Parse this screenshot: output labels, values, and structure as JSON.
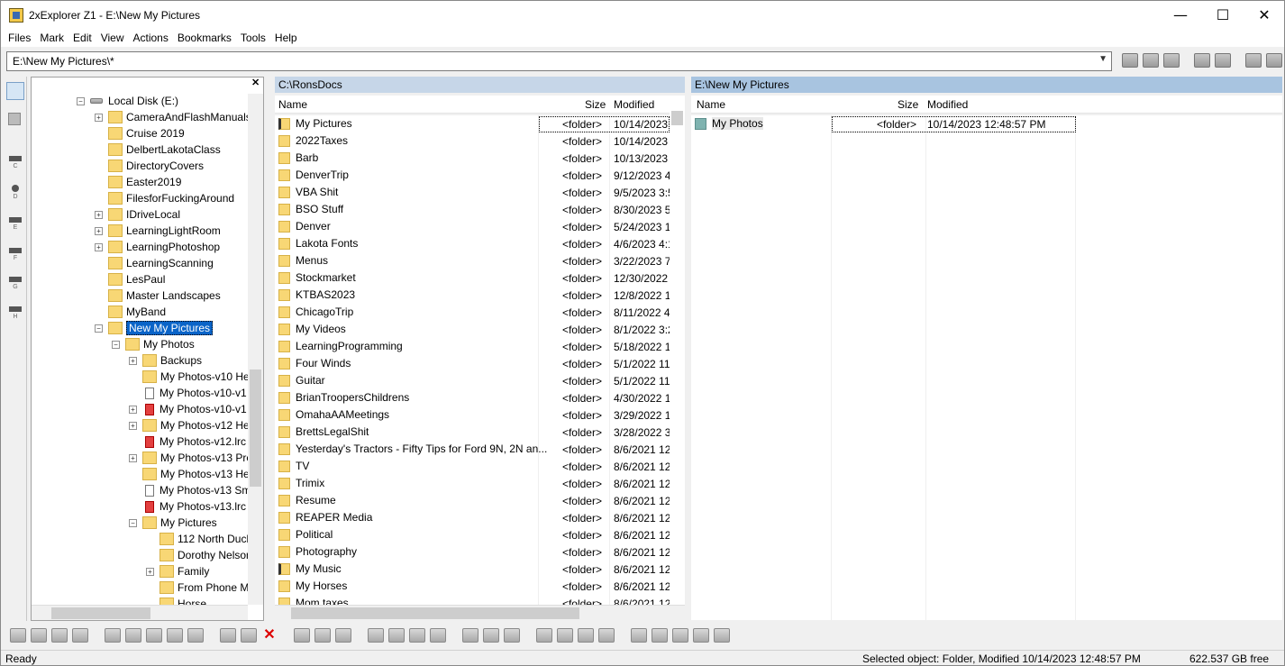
{
  "window": {
    "title": "2xExplorer Z1 - E:\\New My Pictures",
    "minimize": "—",
    "maximize": "☐",
    "close": "✕"
  },
  "menu": [
    "Files",
    "Mark",
    "Edit",
    "View",
    "Actions",
    "Bookmarks",
    "Tools",
    "Help"
  ],
  "path_input": {
    "value": "E:\\New My Pictures\\*"
  },
  "drives": [
    "C",
    "D",
    "E",
    "F",
    "G",
    "H"
  ],
  "tree": {
    "close_label": "✕",
    "nodes": [
      {
        "label": "Local Disk (E:)",
        "level": 0,
        "type": "drive",
        "expand": "-"
      },
      {
        "label": "CameraAndFlashManuals",
        "level": 1,
        "type": "folder",
        "expand": "+"
      },
      {
        "label": "Cruise 2019",
        "level": 1,
        "type": "folder",
        "expand": ""
      },
      {
        "label": "DelbertLakotaClass",
        "level": 1,
        "type": "folder",
        "expand": ""
      },
      {
        "label": "DirectoryCovers",
        "level": 1,
        "type": "folder",
        "expand": ""
      },
      {
        "label": "Easter2019",
        "level": 1,
        "type": "folder",
        "expand": ""
      },
      {
        "label": "FilesforFuckingAround",
        "level": 1,
        "type": "folder",
        "expand": ""
      },
      {
        "label": "IDriveLocal",
        "level": 1,
        "type": "folder",
        "expand": "+"
      },
      {
        "label": "LearningLightRoom",
        "level": 1,
        "type": "folder",
        "expand": "+"
      },
      {
        "label": "LearningPhotoshop",
        "level": 1,
        "type": "folder",
        "expand": "+"
      },
      {
        "label": "LearningScanning",
        "level": 1,
        "type": "folder",
        "expand": ""
      },
      {
        "label": "LesPaul",
        "level": 1,
        "type": "folder",
        "expand": ""
      },
      {
        "label": "Master Landscapes",
        "level": 1,
        "type": "folder",
        "expand": ""
      },
      {
        "label": "MyBand",
        "level": 1,
        "type": "folder",
        "expand": ""
      },
      {
        "label": "New My Pictures",
        "level": 1,
        "type": "folder",
        "expand": "-",
        "selected": true
      },
      {
        "label": "My Photos",
        "level": 2,
        "type": "folder",
        "expand": "-"
      },
      {
        "label": "Backups",
        "level": 3,
        "type": "folder",
        "expand": "+"
      },
      {
        "label": "My Photos-v10 He",
        "level": 3,
        "type": "folder",
        "expand": ""
      },
      {
        "label": "My Photos-v10-v1",
        "level": 3,
        "type": "doc",
        "expand": ""
      },
      {
        "label": "My Photos-v10-v1",
        "level": 3,
        "type": "docred",
        "expand": "+"
      },
      {
        "label": "My Photos-v12 He",
        "level": 3,
        "type": "folder",
        "expand": "+"
      },
      {
        "label": "My Photos-v12.lrc",
        "level": 3,
        "type": "docred",
        "expand": ""
      },
      {
        "label": "My Photos-v13 Pre",
        "level": 3,
        "type": "folder",
        "expand": "+"
      },
      {
        "label": "My Photos-v13 He",
        "level": 3,
        "type": "folder",
        "expand": ""
      },
      {
        "label": "My Photos-v13 Sm",
        "level": 3,
        "type": "doc",
        "expand": ""
      },
      {
        "label": "My Photos-v13.lrc",
        "level": 3,
        "type": "docred",
        "expand": ""
      },
      {
        "label": "My Pictures",
        "level": 3,
        "type": "folder",
        "expand": "-"
      },
      {
        "label": "112 North Duck",
        "level": 4,
        "type": "folder",
        "expand": ""
      },
      {
        "label": "Dorothy Nelson",
        "level": 4,
        "type": "folder",
        "expand": ""
      },
      {
        "label": "Family",
        "level": 4,
        "type": "folder",
        "expand": "+"
      },
      {
        "label": "From Phone M",
        "level": 4,
        "type": "folder",
        "expand": ""
      },
      {
        "label": "Horse",
        "level": 4,
        "type": "folder",
        "expand": ""
      }
    ]
  },
  "left_pane": {
    "path": "C:\\RonsDocs",
    "columns": {
      "name": "Name",
      "size": "Size",
      "modified": "Modified"
    },
    "rows": [
      {
        "name": "My Pictures",
        "size": "<folder>",
        "modified": "10/14/2023",
        "special": true
      },
      {
        "name": "2022Taxes",
        "size": "<folder>",
        "modified": "10/14/2023"
      },
      {
        "name": "Barb",
        "size": "<folder>",
        "modified": "10/13/2023"
      },
      {
        "name": "DenverTrip",
        "size": "<folder>",
        "modified": "9/12/2023 4"
      },
      {
        "name": "VBA Shit",
        "size": "<folder>",
        "modified": "9/5/2023 3:5"
      },
      {
        "name": "BSO Stuff",
        "size": "<folder>",
        "modified": "8/30/2023 5"
      },
      {
        "name": "Denver",
        "size": "<folder>",
        "modified": "5/24/2023 1"
      },
      {
        "name": "Lakota Fonts",
        "size": "<folder>",
        "modified": "4/6/2023 4:1"
      },
      {
        "name": "Menus",
        "size": "<folder>",
        "modified": "3/22/2023 7"
      },
      {
        "name": "Stockmarket",
        "size": "<folder>",
        "modified": "12/30/2022"
      },
      {
        "name": "KTBAS2023",
        "size": "<folder>",
        "modified": "12/8/2022 1"
      },
      {
        "name": "ChicagoTrip",
        "size": "<folder>",
        "modified": "8/11/2022 4"
      },
      {
        "name": "My Videos",
        "size": "<folder>",
        "modified": "8/1/2022 3:2"
      },
      {
        "name": "LearningProgramming",
        "size": "<folder>",
        "modified": "5/18/2022 1"
      },
      {
        "name": "Four Winds",
        "size": "<folder>",
        "modified": "5/1/2022 11"
      },
      {
        "name": "Guitar",
        "size": "<folder>",
        "modified": "5/1/2022 11"
      },
      {
        "name": "BrianTroopersChildrens",
        "size": "<folder>",
        "modified": "4/30/2022 1"
      },
      {
        "name": "OmahaAAMeetings",
        "size": "<folder>",
        "modified": "3/29/2022 1"
      },
      {
        "name": "BrettsLegalShit",
        "size": "<folder>",
        "modified": "3/28/2022 3"
      },
      {
        "name": "Yesterday's Tractors - Fifty Tips for Ford 9N, 2N an...",
        "size": "<folder>",
        "modified": "8/6/2021 12"
      },
      {
        "name": "TV",
        "size": "<folder>",
        "modified": "8/6/2021 12"
      },
      {
        "name": "Trimix",
        "size": "<folder>",
        "modified": "8/6/2021 12"
      },
      {
        "name": "Resume",
        "size": "<folder>",
        "modified": "8/6/2021 12"
      },
      {
        "name": "REAPER Media",
        "size": "<folder>",
        "modified": "8/6/2021 12"
      },
      {
        "name": "Political",
        "size": "<folder>",
        "modified": "8/6/2021 12"
      },
      {
        "name": "Photography",
        "size": "<folder>",
        "modified": "8/6/2021 12"
      },
      {
        "name": "My Music",
        "size": "<folder>",
        "modified": "8/6/2021 12",
        "special": true
      },
      {
        "name": "My Horses",
        "size": "<folder>",
        "modified": "8/6/2021 12"
      },
      {
        "name": "Mom taxes",
        "size": "<folder>",
        "modified": "8/6/2021 12"
      }
    ]
  },
  "right_pane": {
    "path": "E:\\New My Pictures",
    "columns": {
      "name": "Name",
      "size": "Size",
      "modified": "Modified"
    },
    "rows": [
      {
        "name": "My Photos",
        "size": "<folder>",
        "modified": "10/14/2023 12:48:57 PM"
      }
    ]
  },
  "status": {
    "left": "Ready",
    "middle": "Selected object: Folder, Modified 10/14/2023 12:48:57 PM",
    "right": "622.537 GB free"
  },
  "colors": {
    "pane_header": "#c6d6e8",
    "pane_header_active": "#a8c4e0",
    "selection": "#0a64c8",
    "folder": "#f8d775"
  }
}
